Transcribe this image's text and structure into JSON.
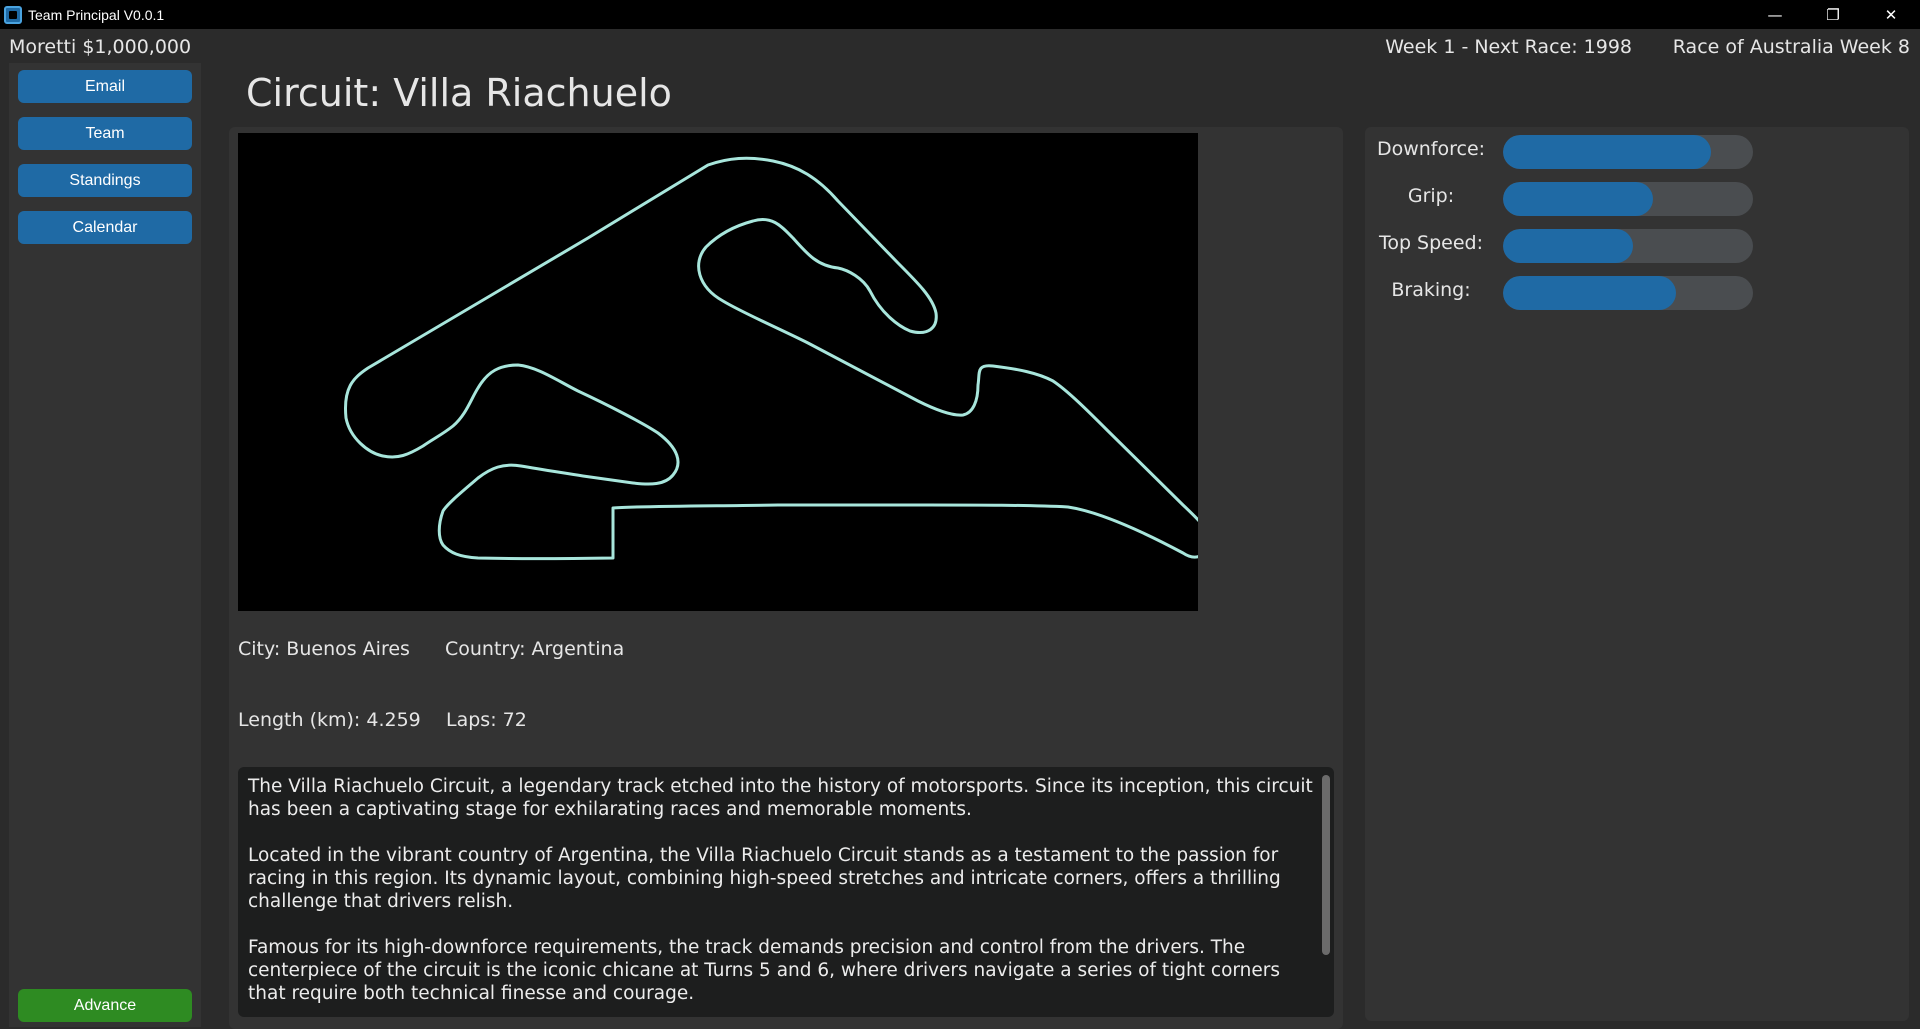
{
  "window": {
    "title": "Team Principal V0.0.1",
    "controls": [
      "minimize",
      "restore",
      "close"
    ],
    "control_glyphs": {
      "minimize": "—",
      "restore": "❐",
      "close": "✕"
    }
  },
  "header": {
    "player": "Moretti $1,000,000",
    "week_info": "Week 1 - Next Race: 1998",
    "next_race": "Race of Australia Week 8"
  },
  "sidebar": {
    "items": [
      {
        "label": "Email"
      },
      {
        "label": "Team"
      },
      {
        "label": "Standings"
      },
      {
        "label": "Calendar"
      }
    ],
    "advance_label": "Advance"
  },
  "circuit": {
    "title": "Circuit: Villa Riachuelo",
    "city": "City: Buenos Aires",
    "country": "Country: Argentina",
    "length": "Length (km): 4.259",
    "laps": "Laps: 72",
    "track_color": "#a8e6dc",
    "description": [
      "The Villa Riachuelo Circuit, a legendary track etched into the history of motorsports. Since its inception, this circuit has been a captivating stage for exhilarating races and memorable moments.",
      "Located in the vibrant country of Argentina, the Villa Riachuelo Circuit stands as a testament to the passion for racing in this region. Its dynamic layout, combining high-speed stretches and intricate corners, offers a thrilling challenge that drivers relish.",
      "Famous for its high-downforce requirements, the track demands precision and control from the drivers. The centerpiece of the circuit is the iconic chicane at Turns 5 and 6, where drivers navigate a series of tight corners that require both technical finesse and courage."
    ]
  },
  "stats": [
    {
      "label": "Downforce:",
      "fraction": 0.83
    },
    {
      "label": "Grip:",
      "fraction": 0.6
    },
    {
      "label": "Top Speed:",
      "fraction": 0.52
    },
    {
      "label": "Braking:",
      "fraction": 0.69
    }
  ],
  "colors": {
    "accent": "#1f6aa5",
    "advance": "#2e8b22",
    "panel": "#333333",
    "background": "#2b2b2b"
  }
}
